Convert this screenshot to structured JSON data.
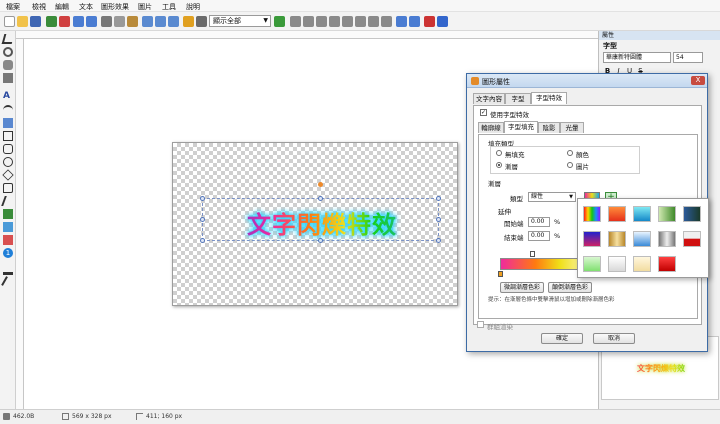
{
  "menu": [
    "檔案",
    "檢視",
    "編輯",
    "文本",
    "圖形效果",
    "圖片",
    "工具",
    "說明"
  ],
  "toolbar": {
    "zoom_value": "顯示全部"
  },
  "canvas": {
    "art_text": "文字閃爍特效"
  },
  "status": {
    "file_size": "462.0B",
    "dimensions": "569 x 328 px",
    "cursor": "411; 160 px"
  },
  "right_panel": {
    "title": "屬性",
    "section": "字型",
    "font_name": "華康新特圓體",
    "font_size": "54",
    "format_buttons": [
      "B",
      "I",
      "U",
      "S"
    ],
    "preview_text": "文字閃爍特效"
  },
  "dialog": {
    "title": "圖形屬性",
    "close_glyph": "X",
    "tabs": [
      "文字內容",
      "字型",
      "字型特效"
    ],
    "use_effect_label": "使用字型特效",
    "subtabs": [
      "輪廓線",
      "字型填充",
      "陰影",
      "光暈"
    ],
    "fill_type_label": "填充類型",
    "fill_options": [
      "無填充",
      "顏色",
      "漸層",
      "圖片"
    ],
    "gradient_section": "漸層",
    "type_label": "類型",
    "type_value": "線性",
    "extend_label": "延伸",
    "start_label": "開始端",
    "start_value": "0.00",
    "end_label": "結束端",
    "end_value": "0.00",
    "percent": "%",
    "fine_tune_button": "微調漸層色彩",
    "reverse_button": "顛倒漸層色彩",
    "hint": "提示：在漸層色條中雙擊滑鼠以增加或刪除漸層色彩",
    "group_label": "群組渲染",
    "ok_button": "確定",
    "cancel_button": "取消"
  },
  "colors": {
    "accent": "#3d6ba5",
    "text_gradient": [
      "#3b3bf0",
      "#f02a9c",
      "#ff7a10",
      "#f0e018",
      "#17d017",
      "#1aa8ef"
    ],
    "glow": "#2ed6ff"
  }
}
